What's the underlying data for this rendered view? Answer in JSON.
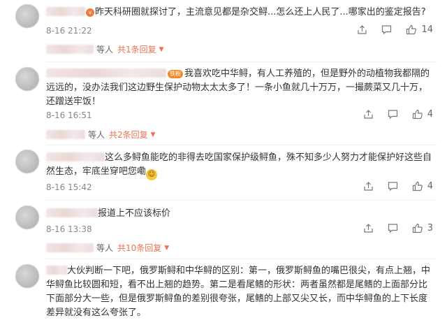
{
  "comments": [
    {
      "text": "昨天科研圈就探讨了，主流意见都是杂交鲟...怎么还上人民了...哪家出的鉴定报告?",
      "time": "8-16 21:22",
      "likes": "14",
      "replies": {
        "prefix": "等人",
        "label": "共1条回复"
      }
    },
    {
      "badge": "铁粉",
      "text": "我喜欢吃中华鲟，有人工养殖的，但是野外的动植物我都隔的远远的，没办法我们这边野生保护动物太太太多了！一条小鱼就几十万万，一撮蕨菜又几十万，还蹭送牢饭！",
      "time": "8-16 16:51",
      "likes": "4",
      "replies": {
        "prefix": "等人",
        "label": "共2条回复"
      }
    },
    {
      "text": "这么多鲟鱼能吃的非得去吃国家保护级鲟鱼，殊不知多少人努力才能保护好这些自然生态，牢底坐穿吧您嘞",
      "time": "8-16 15:42",
      "likes": "4"
    },
    {
      "text": "报道上不应该标价",
      "time": "8-16 13:38",
      "likes": "3",
      "replies": {
        "prefix": "等人",
        "label": "共10条回复"
      }
    },
    {
      "text": "大伙判断一下吧，俄罗斯鲟和中华鲟的区别：第一，俄罗斯鲟鱼的嘴巴很尖，有点上翘，中华鲟鱼比较圆和短，看不出上翘的趋势。第二是看尾鳍的形状：两者虽然都是尾鳍的上面部分比下面部分大一些，但是俄罗斯鲟鱼的差别很夸张，尾鳍的上部又尖又长，而中华鲟鱼的上下长度差异就没有这么夸张了。"
    }
  ],
  "icons": [
    "share-icon",
    "comment-icon",
    "like-icon",
    "chevron-down-icon",
    "emoji-icon"
  ],
  "colors": {
    "accent": "#eb7350",
    "meta": "#888888",
    "text": "#333333"
  }
}
